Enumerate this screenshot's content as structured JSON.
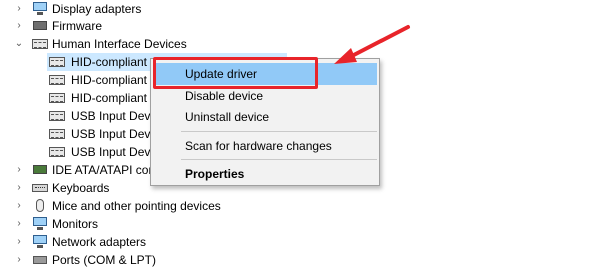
{
  "tree": {
    "items": [
      {
        "label": "Display adapters",
        "icon": "display-adapter-icon",
        "expanded": false
      },
      {
        "label": "Firmware",
        "icon": "firmware-icon",
        "expanded": false
      },
      {
        "label": "Human Interface Devices",
        "icon": "hid-icon",
        "expanded": true
      },
      {
        "label": "HID-compliant",
        "icon": "hid-device-icon",
        "child": true,
        "selected": true
      },
      {
        "label": "HID-compliant",
        "icon": "hid-device-icon",
        "child": true
      },
      {
        "label": "HID-compliant",
        "icon": "hid-device-icon",
        "child": true
      },
      {
        "label": "USB Input Devi",
        "icon": "hid-device-icon",
        "child": true
      },
      {
        "label": "USB Input Devi",
        "icon": "hid-device-icon",
        "child": true
      },
      {
        "label": "USB Input Devi",
        "icon": "hid-device-icon",
        "child": true
      },
      {
        "label": "IDE ATA/ATAPI con",
        "icon": "ide-controller-icon",
        "expanded": false
      },
      {
        "label": "Keyboards",
        "icon": "keyboard-icon",
        "expanded": false
      },
      {
        "label": "Mice and other pointing devices",
        "icon": "mouse-icon",
        "expanded": false
      },
      {
        "label": "Monitors",
        "icon": "monitor-icon",
        "expanded": false
      },
      {
        "label": "Network adapters",
        "icon": "network-adapter-icon",
        "expanded": false
      },
      {
        "label": "Ports (COM & LPT)",
        "icon": "port-icon",
        "expanded": false
      }
    ]
  },
  "context_menu": {
    "update_driver": "Update driver",
    "disable_device": "Disable device",
    "uninstall_device": "Uninstall device",
    "scan_hardware": "Scan for hardware changes",
    "properties": "Properties"
  },
  "annotation": {
    "color": "#e8242a"
  }
}
